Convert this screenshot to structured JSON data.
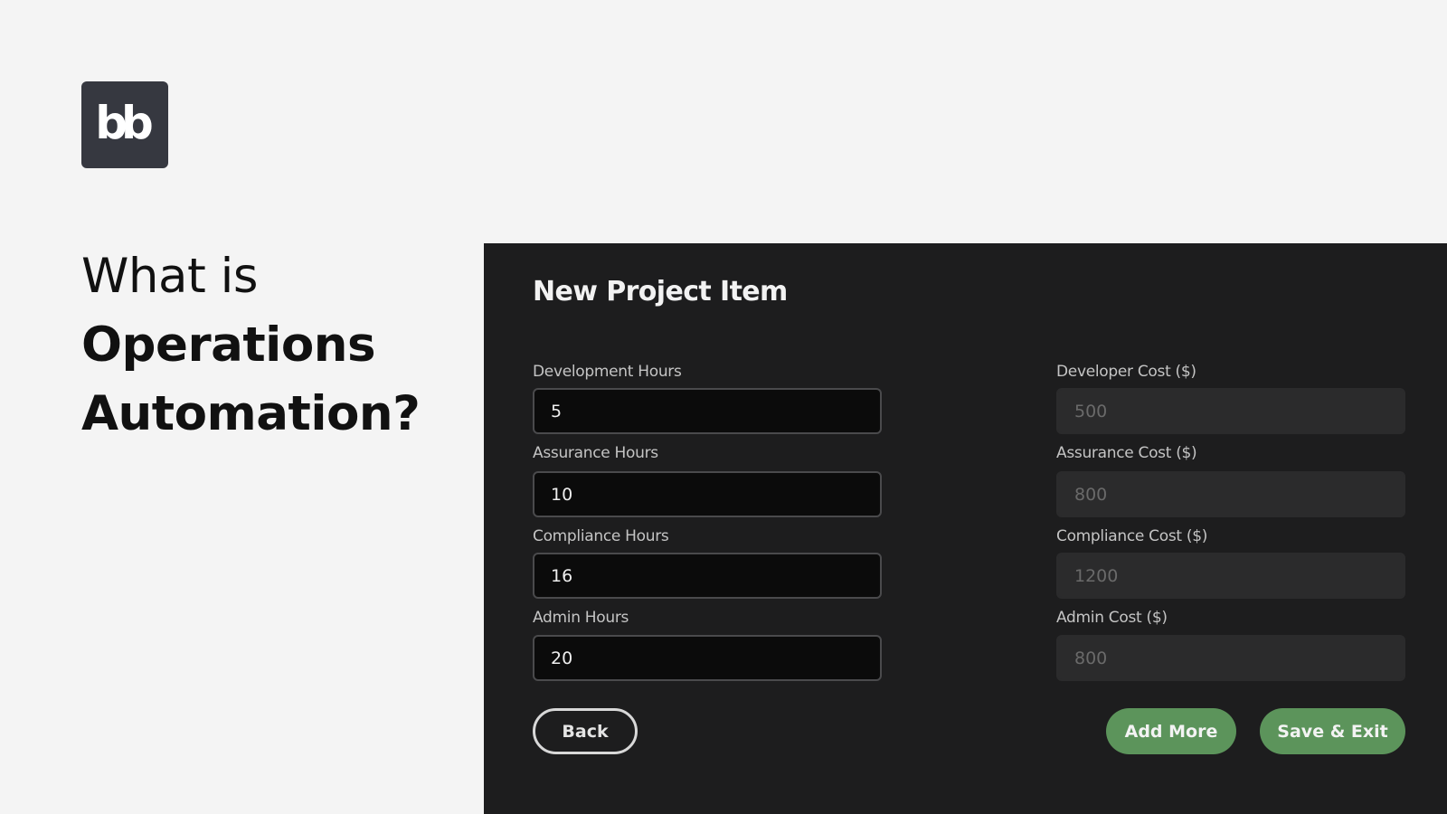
{
  "logo": {
    "text": "bb"
  },
  "headline": {
    "line1": "What is",
    "line2": "Operations",
    "line3": "Automation?"
  },
  "form": {
    "title": "New Project Item",
    "left_fields": [
      {
        "label": "Development Hours",
        "value": "5"
      },
      {
        "label": "Assurance Hours",
        "value": "10"
      },
      {
        "label": "Compliance Hours",
        "value": "16"
      },
      {
        "label": "Admin Hours",
        "value": "20"
      }
    ],
    "right_fields": [
      {
        "label": "Developer Cost ($)",
        "value": "500"
      },
      {
        "label": "Assurance Cost ($)",
        "value": "800"
      },
      {
        "label": "Compliance Cost ($)",
        "value": "1200"
      },
      {
        "label": "Admin Cost ($)",
        "value": "800"
      }
    ],
    "buttons": {
      "back": "Back",
      "add_more": "Add More",
      "save_exit": "Save & Exit"
    }
  },
  "colors": {
    "page_bg": "#f4f4f4",
    "panel_bg": "#1d1d1e",
    "logo_bg": "#363840",
    "accent_green": "#5c945b"
  }
}
